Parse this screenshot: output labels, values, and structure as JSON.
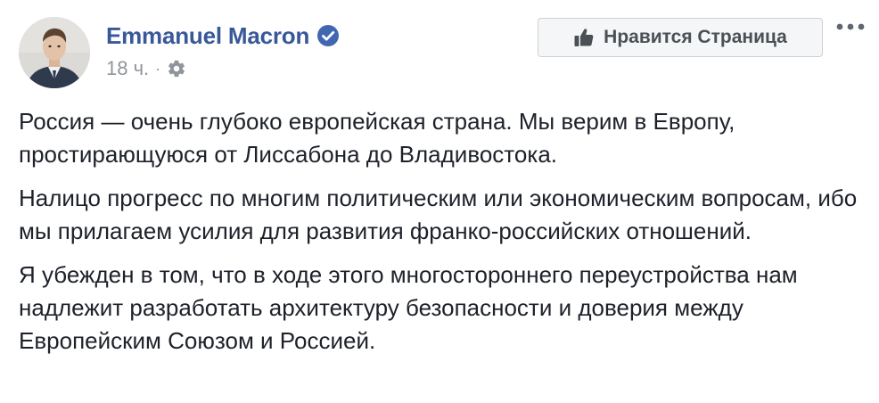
{
  "post": {
    "author": {
      "name": "Emmanuel Macron",
      "verified": true,
      "avatar_icon": "profile-photo"
    },
    "meta": {
      "time": "18 ч.",
      "separator": "·",
      "audience_icon": "gear-icon"
    },
    "actions": {
      "like_page_label": "Нравится Страница",
      "like_icon": "thumbs-up-icon",
      "more_icon": "more-options-icon"
    },
    "paragraphs": [
      "Россия — очень глубоко европейская страна. Мы верим в Европу, простирающуюся от Лиссабона до Владивостока.",
      "Налицо прогресс по многим политическим или экономическим вопросам, ибо мы прилагаем усилия для развития франко-российских отношений.",
      "Я убежден в том, что в ходе этого многостороннего переустройства нам надлежит разработать архитектуру безопасности и доверия между Европейским Союзом и Россией."
    ]
  },
  "colors": {
    "author_link": "#385898",
    "verified_badge": "#4267b2",
    "meta_text": "#90949c",
    "body_text": "#1d2129",
    "button_bg": "#f5f6f7",
    "button_border": "#ced0d4",
    "button_text": "#4b4f56"
  }
}
